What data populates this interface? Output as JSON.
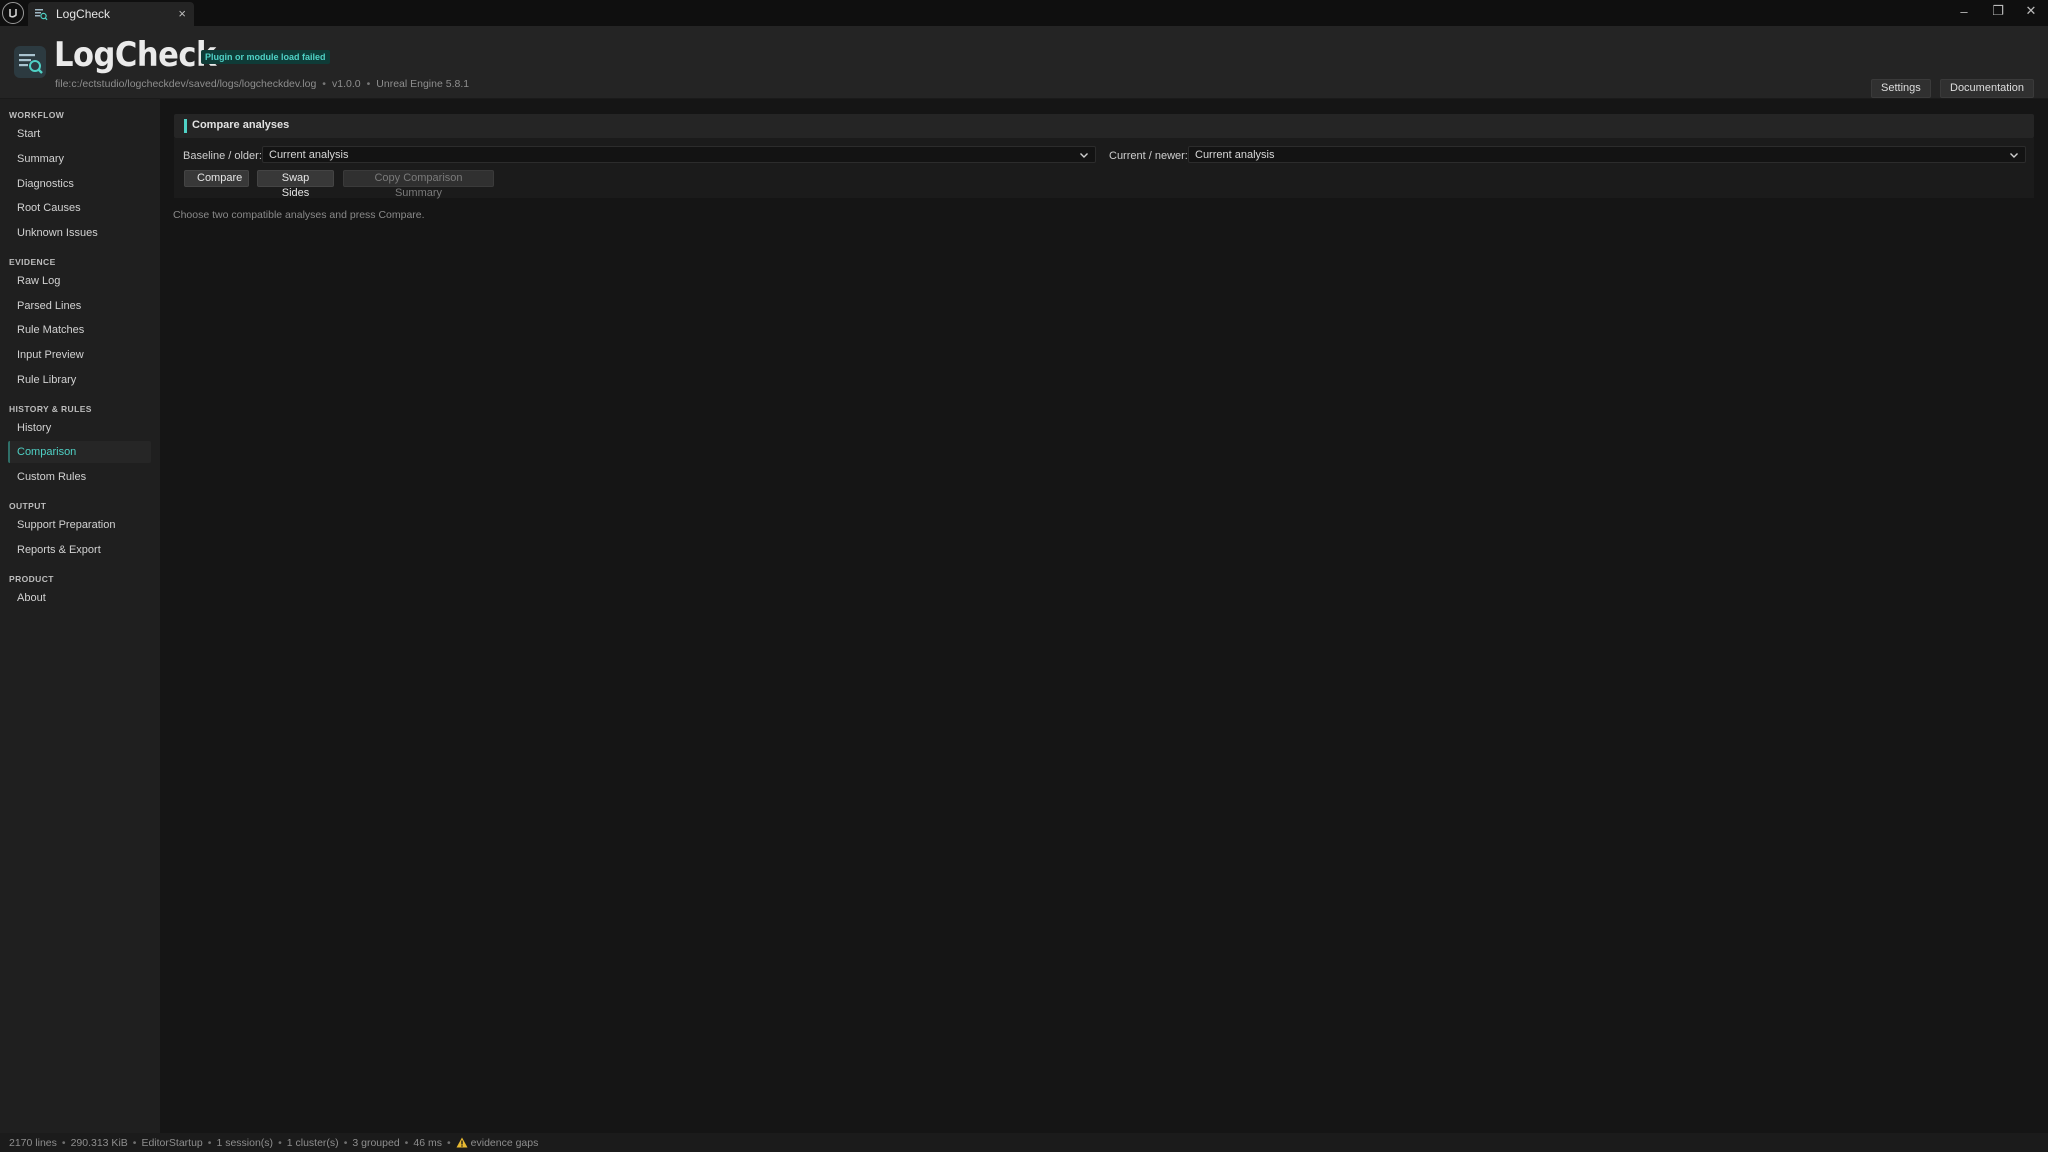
{
  "window": {
    "tab_label": "LogCheck",
    "tab_close_glyph": "×",
    "min_glyph": "–",
    "restore_glyph": "❐",
    "close_glyph": "✕"
  },
  "header": {
    "title": "LogCheck",
    "badge": "Plugin or module load failed",
    "file": "file:c:/ectstudio/logcheckdev/saved/logs/logcheckdev.log",
    "version": "v1.0.0",
    "engine": "Unreal Engine 5.8.1",
    "meta_separator": "•",
    "settings_label": "Settings",
    "documentation_label": "Documentation"
  },
  "sidebar": {
    "sections": [
      {
        "title": "WORKFLOW",
        "items": [
          "Start",
          "Summary",
          "Diagnostics",
          "Root Causes",
          "Unknown Issues"
        ]
      },
      {
        "title": "EVIDENCE",
        "items": [
          "Raw Log",
          "Parsed Lines",
          "Rule Matches",
          "Input Preview",
          "Rule Library"
        ]
      },
      {
        "title": "HISTORY & RULES",
        "items": [
          "History",
          "Comparison",
          "Custom Rules"
        ]
      },
      {
        "title": "OUTPUT",
        "items": [
          "Support Preparation",
          "Reports & Export"
        ]
      },
      {
        "title": "PRODUCT",
        "items": [
          "About"
        ]
      }
    ],
    "active_item": "Comparison"
  },
  "compare": {
    "panel_title": "Compare analyses",
    "baseline_label": "Baseline / older:",
    "baseline_value": "Current analysis",
    "current_label": "Current / newer:",
    "current_value": "Current analysis",
    "compare_label": "Compare",
    "swap_label": "Swap Sides",
    "copy_label": "Copy Comparison Summary",
    "hint": "Choose two compatible analyses and press Compare."
  },
  "status": {
    "separator": "•",
    "lines": "2170 lines",
    "size": "290.313 KiB",
    "phase": "EditorStartup",
    "sessions": "1 session(s)",
    "clusters": "1 cluster(s)",
    "grouped": "3 grouped",
    "duration": "46 ms",
    "gaps": "evidence gaps"
  },
  "colors": {
    "accent": "#4fd1c5",
    "warning": "#e8b931"
  }
}
